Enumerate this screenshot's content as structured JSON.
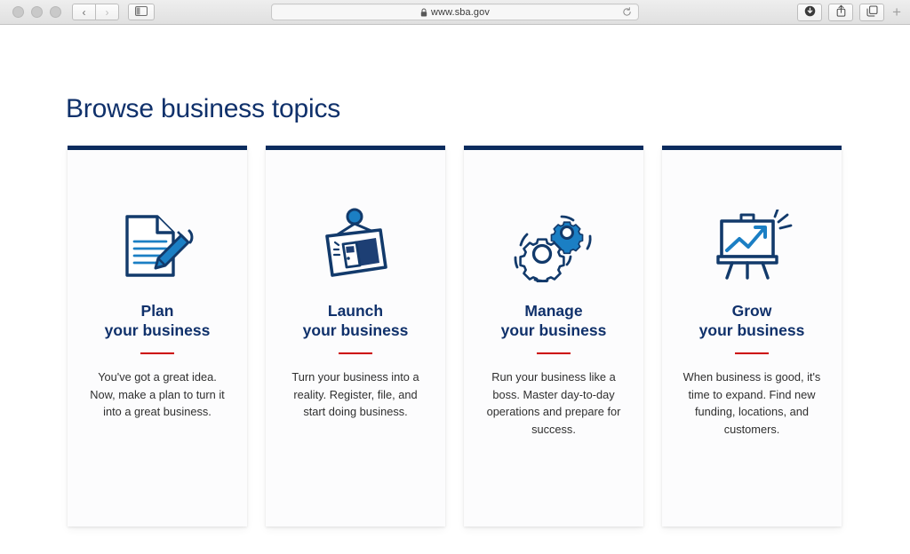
{
  "browser": {
    "traffic_lights": [
      "close",
      "minimize",
      "maximize"
    ],
    "back_label": "‹",
    "forward_label": "›",
    "sidebar_label": "sidebar-toggle",
    "url": "www.sba.gov",
    "lock": "secure-lock",
    "reload_label": "↻",
    "downloads_label": "downloads",
    "share_label": "share",
    "tabs_label": "show-tabs",
    "new_tab_label": "+"
  },
  "page": {
    "title": "Browse business topics",
    "title_color": "#10316b",
    "accent_bar_color": "#0b2c5e",
    "rule_color": "#cc0000",
    "icon_navy": "#123a6b",
    "icon_blue": "#1b7fc4",
    "cards": [
      {
        "icon": "document-pencil-icon",
        "title_line1": "Plan",
        "title_line2": "your business",
        "body": "You've got a great idea. Now, make a plan to turn it into a great business."
      },
      {
        "icon": "hanging-sign-door-icon",
        "title_line1": "Launch",
        "title_line2": "your business",
        "body": "Turn your business into a reality. Register, file, and start doing business."
      },
      {
        "icon": "gears-icon",
        "title_line1": "Manage",
        "title_line2": "your business",
        "body": "Run your business like a boss. Master day-to-day operations and prepare for success."
      },
      {
        "icon": "easel-growth-chart-icon",
        "title_line1": "Grow",
        "title_line2": "your business",
        "body": "When business is good, it's time to expand. Find new funding, locations, and customers."
      }
    ]
  }
}
